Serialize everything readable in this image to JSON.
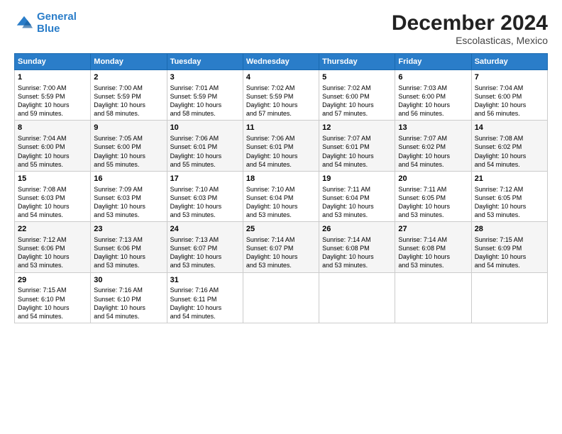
{
  "logo": {
    "line1": "General",
    "line2": "Blue"
  },
  "title": "December 2024",
  "subtitle": "Escolasticas, Mexico",
  "days_header": [
    "Sunday",
    "Monday",
    "Tuesday",
    "Wednesday",
    "Thursday",
    "Friday",
    "Saturday"
  ],
  "weeks": [
    [
      {
        "day": "1",
        "sunrise": "7:00 AM",
        "sunset": "5:59 PM",
        "daylight": "10 hours and 59 minutes."
      },
      {
        "day": "2",
        "sunrise": "7:00 AM",
        "sunset": "5:59 PM",
        "daylight": "10 hours and 58 minutes."
      },
      {
        "day": "3",
        "sunrise": "7:01 AM",
        "sunset": "5:59 PM",
        "daylight": "10 hours and 58 minutes."
      },
      {
        "day": "4",
        "sunrise": "7:02 AM",
        "sunset": "5:59 PM",
        "daylight": "10 hours and 57 minutes."
      },
      {
        "day": "5",
        "sunrise": "7:02 AM",
        "sunset": "6:00 PM",
        "daylight": "10 hours and 57 minutes."
      },
      {
        "day": "6",
        "sunrise": "7:03 AM",
        "sunset": "6:00 PM",
        "daylight": "10 hours and 56 minutes."
      },
      {
        "day": "7",
        "sunrise": "7:04 AM",
        "sunset": "6:00 PM",
        "daylight": "10 hours and 56 minutes."
      }
    ],
    [
      {
        "day": "8",
        "sunrise": "7:04 AM",
        "sunset": "6:00 PM",
        "daylight": "10 hours and 55 minutes."
      },
      {
        "day": "9",
        "sunrise": "7:05 AM",
        "sunset": "6:00 PM",
        "daylight": "10 hours and 55 minutes."
      },
      {
        "day": "10",
        "sunrise": "7:06 AM",
        "sunset": "6:01 PM",
        "daylight": "10 hours and 55 minutes."
      },
      {
        "day": "11",
        "sunrise": "7:06 AM",
        "sunset": "6:01 PM",
        "daylight": "10 hours and 54 minutes."
      },
      {
        "day": "12",
        "sunrise": "7:07 AM",
        "sunset": "6:01 PM",
        "daylight": "10 hours and 54 minutes."
      },
      {
        "day": "13",
        "sunrise": "7:07 AM",
        "sunset": "6:02 PM",
        "daylight": "10 hours and 54 minutes."
      },
      {
        "day": "14",
        "sunrise": "7:08 AM",
        "sunset": "6:02 PM",
        "daylight": "10 hours and 54 minutes."
      }
    ],
    [
      {
        "day": "15",
        "sunrise": "7:08 AM",
        "sunset": "6:03 PM",
        "daylight": "10 hours and 54 minutes."
      },
      {
        "day": "16",
        "sunrise": "7:09 AM",
        "sunset": "6:03 PM",
        "daylight": "10 hours and 53 minutes."
      },
      {
        "day": "17",
        "sunrise": "7:10 AM",
        "sunset": "6:03 PM",
        "daylight": "10 hours and 53 minutes."
      },
      {
        "day": "18",
        "sunrise": "7:10 AM",
        "sunset": "6:04 PM",
        "daylight": "10 hours and 53 minutes."
      },
      {
        "day": "19",
        "sunrise": "7:11 AM",
        "sunset": "6:04 PM",
        "daylight": "10 hours and 53 minutes."
      },
      {
        "day": "20",
        "sunrise": "7:11 AM",
        "sunset": "6:05 PM",
        "daylight": "10 hours and 53 minutes."
      },
      {
        "day": "21",
        "sunrise": "7:12 AM",
        "sunset": "6:05 PM",
        "daylight": "10 hours and 53 minutes."
      }
    ],
    [
      {
        "day": "22",
        "sunrise": "7:12 AM",
        "sunset": "6:06 PM",
        "daylight": "10 hours and 53 minutes."
      },
      {
        "day": "23",
        "sunrise": "7:13 AM",
        "sunset": "6:06 PM",
        "daylight": "10 hours and 53 minutes."
      },
      {
        "day": "24",
        "sunrise": "7:13 AM",
        "sunset": "6:07 PM",
        "daylight": "10 hours and 53 minutes."
      },
      {
        "day": "25",
        "sunrise": "7:14 AM",
        "sunset": "6:07 PM",
        "daylight": "10 hours and 53 minutes."
      },
      {
        "day": "26",
        "sunrise": "7:14 AM",
        "sunset": "6:08 PM",
        "daylight": "10 hours and 53 minutes."
      },
      {
        "day": "27",
        "sunrise": "7:14 AM",
        "sunset": "6:08 PM",
        "daylight": "10 hours and 53 minutes."
      },
      {
        "day": "28",
        "sunrise": "7:15 AM",
        "sunset": "6:09 PM",
        "daylight": "10 hours and 54 minutes."
      }
    ],
    [
      {
        "day": "29",
        "sunrise": "7:15 AM",
        "sunset": "6:10 PM",
        "daylight": "10 hours and 54 minutes."
      },
      {
        "day": "30",
        "sunrise": "7:16 AM",
        "sunset": "6:10 PM",
        "daylight": "10 hours and 54 minutes."
      },
      {
        "day": "31",
        "sunrise": "7:16 AM",
        "sunset": "6:11 PM",
        "daylight": "10 hours and 54 minutes."
      },
      null,
      null,
      null,
      null
    ]
  ],
  "labels": {
    "sunrise": "Sunrise: ",
    "sunset": "Sunset: ",
    "daylight": "Daylight: "
  }
}
